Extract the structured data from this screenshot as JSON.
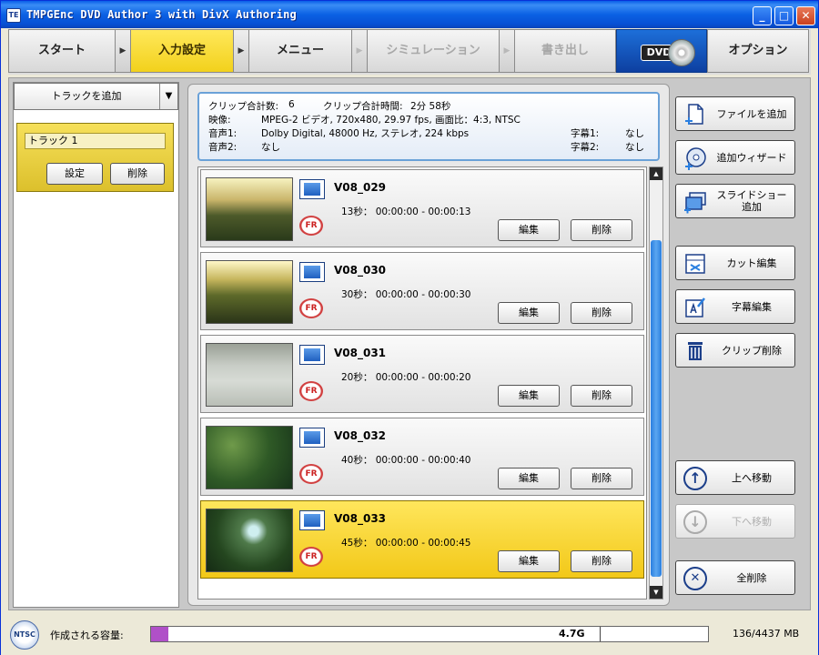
{
  "window": {
    "title": "TMPGEnc DVD Author 3 with DivX Authoring",
    "app_icon": "TE",
    "controls": {
      "minimize": "_",
      "maximize": "□",
      "close": "✕"
    }
  },
  "steps": [
    {
      "label": "スタート",
      "state": "normal"
    },
    {
      "label": "入力設定",
      "state": "active"
    },
    {
      "label": "メニュー",
      "state": "normal"
    },
    {
      "label": "シミュレーション",
      "state": "disabled"
    },
    {
      "label": "書き出し",
      "state": "disabled"
    },
    {
      "label": "DVD",
      "state": "logo"
    },
    {
      "label": "オプション",
      "state": "normal"
    }
  ],
  "step_arrow": "▶",
  "left": {
    "dropdown_label": "トラックを追加",
    "dropdown_arrow": "▼",
    "track": {
      "name": "トラック 1",
      "settings_label": "設定",
      "delete_label": "削除"
    }
  },
  "info": {
    "clip_count_label": "クリップ合計数:",
    "clip_count": "6",
    "clip_time_label": "クリップ合計時間:",
    "clip_time": "2分 58秒",
    "video_label": "映像:",
    "video": "MPEG-2 ビデオ,  720x480,  29.97 fps,  画面比：4:3,  NTSC",
    "audio1_label": "音声1:",
    "audio1": "Dolby Digital,  48000 Hz,  ステレオ,  224 kbps",
    "audio2_label": "音声2:",
    "audio2": "なし",
    "sub1_label": "字幕1:",
    "sub1": "なし",
    "sub2_label": "字幕2:",
    "sub2": "なし"
  },
  "clips": [
    {
      "name": "V08_029",
      "duration": "13秒：  00:00:00 - 00:00:13",
      "edit_label": "編集",
      "delete_label": "削除",
      "fr_badge": "FR",
      "selected": false
    },
    {
      "name": "V08_030",
      "duration": "30秒：  00:00:00 - 00:00:30",
      "edit_label": "編集",
      "delete_label": "削除",
      "fr_badge": "FR",
      "selected": false
    },
    {
      "name": "V08_031",
      "duration": "20秒：  00:00:00 - 00:00:20",
      "edit_label": "編集",
      "delete_label": "削除",
      "fr_badge": "FR",
      "selected": false
    },
    {
      "name": "V08_032",
      "duration": "40秒：  00:00:00 - 00:00:40",
      "edit_label": "編集",
      "delete_label": "削除",
      "fr_badge": "FR",
      "selected": false
    },
    {
      "name": "V08_033",
      "duration": "45秒：  00:00:00 - 00:00:45",
      "edit_label": "編集",
      "delete_label": "削除",
      "fr_badge": "FR",
      "selected": true
    }
  ],
  "scroll": {
    "up": "▲",
    "down": "▼"
  },
  "actions": {
    "add_file": "ファイルを追加",
    "add_wizard": "追加ウィザード",
    "add_slideshow": "スライドショー\n追加",
    "cut_edit": "カット編集",
    "subtitle_edit": "字幕編集",
    "clip_delete": "クリップ削除",
    "move_up": "上へ移動",
    "move_down": "下へ移動",
    "delete_all": "全削除",
    "icon_up": "↑",
    "icon_down": "↓",
    "icon_x": "✕"
  },
  "status": {
    "ntsc": "NTSC",
    "capacity_label": "作成される容量:",
    "capacity_mark": "4.7G",
    "capacity_used": "136/4437 MB",
    "capacity_fraction": 0.0307
  },
  "colors": {
    "active_step": "#f2d11c",
    "selected_clip": "#f2c818",
    "capacity_fill": "#b050c8",
    "scroll_thumb": "#2a7fe0"
  }
}
